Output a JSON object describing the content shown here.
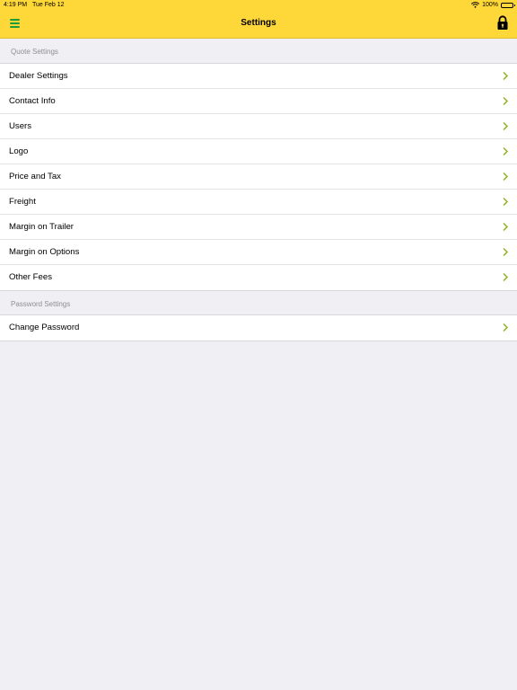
{
  "status_bar": {
    "time": "4:19 PM",
    "date": "Tue Feb 12",
    "battery": "100%",
    "wifi_icon": "wifi-icon",
    "battery_icon": "battery-icon"
  },
  "nav_bar": {
    "title": "Settings",
    "menu_icon": "menu-icon",
    "lock_icon": "lock-icon",
    "background_color": "#fed739",
    "menu_icon_color": "#1f9a3a"
  },
  "sections": [
    {
      "header": "Quote Settings",
      "items": [
        {
          "label": "Dealer Settings"
        },
        {
          "label": "Contact Info"
        },
        {
          "label": "Users"
        },
        {
          "label": "Logo"
        },
        {
          "label": "Price and Tax"
        },
        {
          "label": "Freight"
        },
        {
          "label": "Margin on Trailer"
        },
        {
          "label": "Margin on Options"
        },
        {
          "label": "Other Fees"
        }
      ]
    },
    {
      "header": "Password Settings",
      "items": [
        {
          "label": "Change Password"
        }
      ]
    }
  ],
  "chevron_icon": "chevron-right-icon",
  "chevron_color": "#8fb31f"
}
